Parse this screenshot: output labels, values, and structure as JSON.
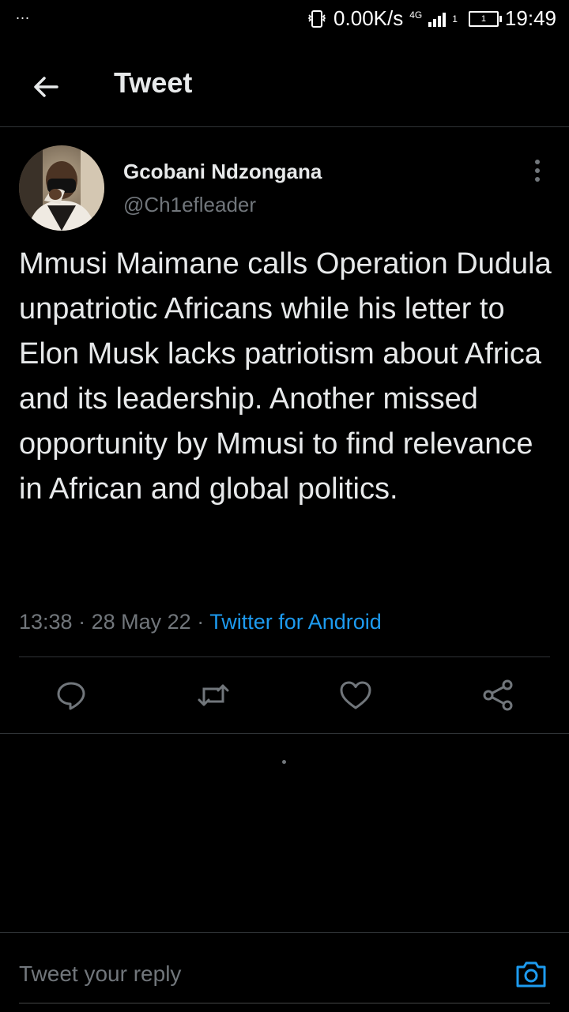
{
  "status_bar": {
    "dots": "...",
    "speed": "0.00K/s",
    "network": "4G",
    "sim": "1",
    "battery": "1",
    "time": "19:49"
  },
  "header": {
    "title": "Tweet",
    "back_icon": "arrow-left-icon"
  },
  "tweet": {
    "author_name": "Gcobani Ndzongana",
    "author_handle": "@Ch1efleader",
    "text": "Mmusi Maimane calls Operation Dudula unpatriotic Africans while his letter to Elon Musk lacks patriotism about Africa and its leadership. Another missed opportunity by Mmusi to find relevance in African and global politics.",
    "time": "13:38",
    "separator": "·",
    "date": "28 May 22",
    "source": "Twitter for Android"
  },
  "actions": [
    {
      "icon": "reply-icon"
    },
    {
      "icon": "retweet-icon"
    },
    {
      "icon": "like-icon"
    },
    {
      "icon": "share-icon"
    }
  ],
  "reply": {
    "placeholder": "Tweet your reply",
    "camera_icon": "camera-icon"
  },
  "colors": {
    "background": "#000000",
    "text": "#e7e9ea",
    "secondary": "#71767b",
    "accent": "#1d9bf0",
    "divider": "#2f3336"
  }
}
